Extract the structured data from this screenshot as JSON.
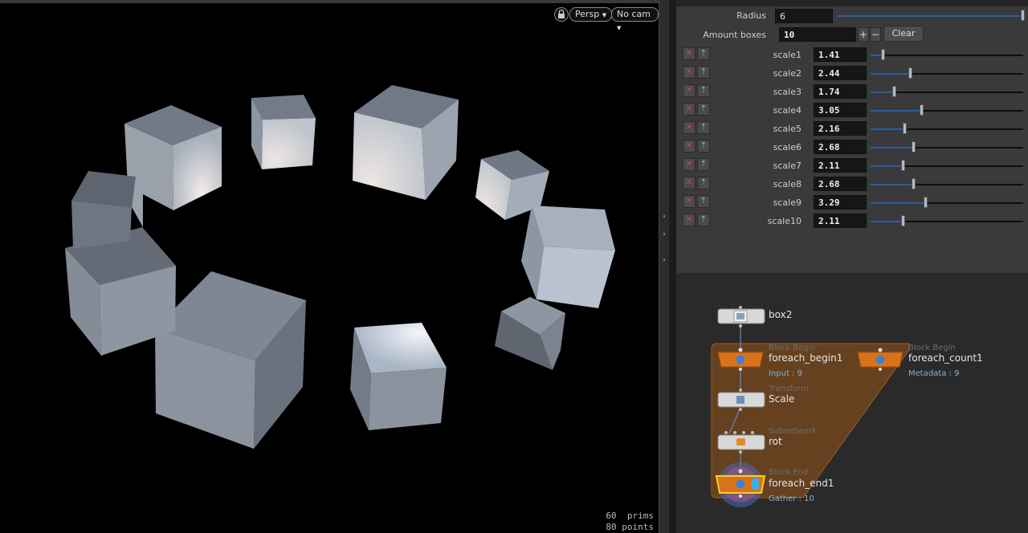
{
  "viewport": {
    "camera_menu": "Persp",
    "cam_menu": "No cam",
    "stats": {
      "prims_count": "60",
      "prims_label": "prims",
      "points_count": "80",
      "points_label": "points"
    }
  },
  "params": {
    "radius_label": "Radius",
    "radius_value": "6",
    "amount_label": "Amount boxes",
    "amount_value": "10",
    "plus": "+",
    "minus": "−",
    "clear_label": "Clear",
    "remove_glyph": "✕",
    "up_glyph": "⇡",
    "scales": [
      {
        "label": "scale1",
        "value": "1.41",
        "level": 0.08
      },
      {
        "label": "scale2",
        "value": "2.44",
        "level": 0.26
      },
      {
        "label": "scale3",
        "value": "1.74",
        "level": 0.15
      },
      {
        "label": "scale4",
        "value": "3.05",
        "level": 0.33
      },
      {
        "label": "scale5",
        "value": "2.16",
        "level": 0.22
      },
      {
        "label": "scale6",
        "value": "2.68",
        "level": 0.28
      },
      {
        "label": "scale7",
        "value": "2.11",
        "level": 0.21
      },
      {
        "label": "scale8",
        "value": "2.68",
        "level": 0.28
      },
      {
        "label": "scale9",
        "value": "3.29",
        "level": 0.36
      },
      {
        "label": "scale10",
        "value": "2.11",
        "level": 0.21
      }
    ]
  },
  "network": {
    "box2": {
      "name": "box2"
    },
    "foreach_begin1": {
      "type": "Block Begin",
      "name": "foreach_begin1",
      "info": "Input : 9"
    },
    "foreach_count1": {
      "type": "Block Begin",
      "name": "foreach_count1",
      "info": "Metadata : 9"
    },
    "scale": {
      "type": "Transform",
      "name": "Scale"
    },
    "rot": {
      "type": "Subnetwork",
      "name": "rot"
    },
    "foreach_end1": {
      "type": "Block End",
      "name": "foreach_end1",
      "info": "Gather : 10"
    }
  },
  "colors": {
    "viewport_bg": "#000000",
    "slider_fill": "#2a5ea0",
    "block_node": "#d9731a",
    "block_region": "#7a4a1c",
    "selected_outline": "#f2d02a",
    "info_text": "#7fb0d8"
  },
  "icons": [
    "lock-icon",
    "dropdown-arrow-icon",
    "remove-icon",
    "move-up-icon"
  ]
}
